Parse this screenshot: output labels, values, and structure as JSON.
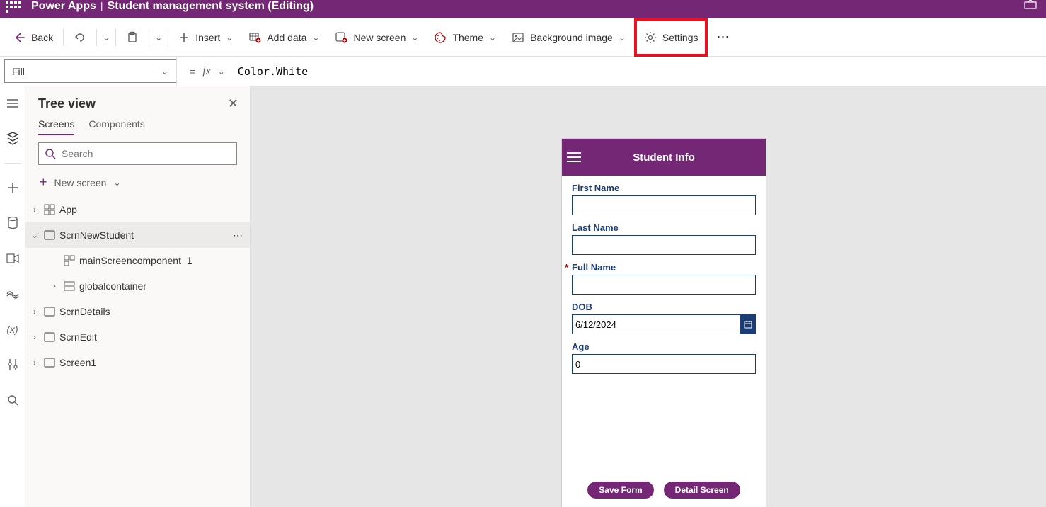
{
  "header": {
    "brand": "Power Apps",
    "app_name": "Student management system (Editing)"
  },
  "toolbar": {
    "back": "Back",
    "insert": "Insert",
    "add_data": "Add data",
    "new_screen": "New screen",
    "theme": "Theme",
    "bg_image": "Background image",
    "settings": "Settings"
  },
  "formula": {
    "property": "Fill",
    "value": "Color.White"
  },
  "tree": {
    "title": "Tree view",
    "tab_screens": "Screens",
    "tab_components": "Components",
    "search_placeholder": "Search",
    "new_screen": "New screen",
    "items": {
      "app": "App",
      "scrn_new": "ScrnNewStudent",
      "main_comp": "mainScreencomponent_1",
      "global_container": "globalcontainer",
      "scrn_details": "ScrnDetails",
      "scrn_edit": "ScrnEdit",
      "screen1": "Screen1"
    }
  },
  "form": {
    "title": "Student Info",
    "first_name": "First Name",
    "last_name": "Last Name",
    "full_name": "Full Name",
    "dob": "DOB",
    "dob_value": "6/12/2024",
    "age": "Age",
    "age_value": "0",
    "save": "Save Form",
    "detail": "Detail Screen"
  }
}
